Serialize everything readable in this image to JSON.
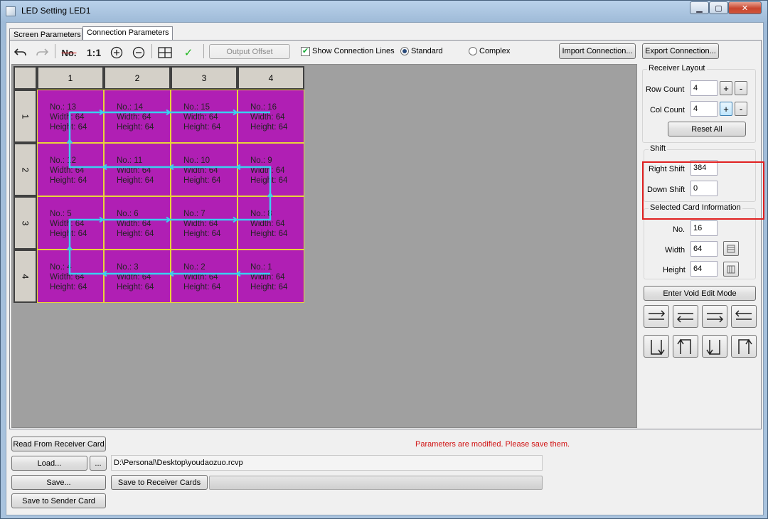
{
  "window": {
    "title": "LED Setting LED1",
    "controls": {
      "minimize": "▁",
      "maximize": "▢",
      "close": "✕"
    }
  },
  "tabs": [
    {
      "label": "Screen Parameters"
    },
    {
      "label": "Connection Parameters"
    }
  ],
  "toolbar": {
    "no_label": "No.",
    "ratio_label": "1:1",
    "output_offset": "Output Offset",
    "show_lines_label": "Show Connection Lines",
    "show_lines_checked": "✔",
    "standard_label": "Standard",
    "complex_label": "Complex",
    "import_label": "Import Connection...",
    "export_label": "Export Connection..."
  },
  "grid": {
    "columns": [
      "1",
      "2",
      "3",
      "4"
    ],
    "rows": [
      "1",
      "2",
      "3",
      "4"
    ],
    "cells": [
      [
        {
          "no": "No.: 13",
          "width": "Width: 64",
          "height": "Height: 64"
        },
        {
          "no": "No.: 14",
          "width": "Width: 64",
          "height": "Height: 64"
        },
        {
          "no": "No.: 15",
          "width": "Width: 64",
          "height": "Height: 64"
        },
        {
          "no": "No.: 16",
          "width": "Width: 64",
          "height": "Height: 64"
        }
      ],
      [
        {
          "no": "No.: 12",
          "width": "Width: 64",
          "height": "Height: 64"
        },
        {
          "no": "No.: 11",
          "width": "Width: 64",
          "height": "Height: 64"
        },
        {
          "no": "No.: 10",
          "width": "Width: 64",
          "height": "Height: 64"
        },
        {
          "no": "No.: 9",
          "width": "Width: 64",
          "height": "Height: 64"
        }
      ],
      [
        {
          "no": "No.: 5",
          "width": "Width: 64",
          "height": "Height: 64"
        },
        {
          "no": "No.: 6",
          "width": "Width: 64",
          "height": "Height: 64"
        },
        {
          "no": "No.: 7",
          "width": "Width: 64",
          "height": "Height: 64"
        },
        {
          "no": "No.: 8",
          "width": "Width: 64",
          "height": "Height: 64"
        }
      ],
      [
        {
          "no": "No.: 4",
          "width": "Width: 64",
          "height": "Height: 64"
        },
        {
          "no": "No.: 3",
          "width": "Width: 64",
          "height": "Height: 64"
        },
        {
          "no": "No.: 2",
          "width": "Width: 64",
          "height": "Height: 64"
        },
        {
          "no": "No.: 1",
          "width": "Width: 64",
          "height": "Height: 64"
        }
      ]
    ],
    "cell_color": "#b01fb4",
    "line_color": "#3ad0f0"
  },
  "receiver_layout": {
    "title": "Receiver Layout",
    "row_count_label": "Row Count",
    "row_count": "4",
    "col_count_label": "Col Count",
    "col_count": "4",
    "plus": "+",
    "minus": "-",
    "reset_label": "Reset All"
  },
  "shift": {
    "title": "Shift",
    "right_label": "Right Shift",
    "right_value": "384",
    "down_label": "Down Shift",
    "down_value": "0",
    "highlight_color": "#e02020"
  },
  "card_info": {
    "title": "Selected Card Information",
    "no_label": "No.",
    "no_value": "16",
    "width_label": "Width",
    "width_value": "64",
    "height_label": "Height",
    "height_value": "64"
  },
  "void_edit_label": "Enter Void Edit Mode",
  "direction_buttons": [
    "row-right-icon",
    "row-left-icon",
    "row-right-alt-icon",
    "row-left-alt-icon",
    "col-down-icon",
    "col-up-icon",
    "col-down-alt-icon",
    "col-up-alt-icon"
  ],
  "bottom": {
    "read_label": "Read From Receiver Card",
    "warning": "Parameters are modified. Please save them.",
    "warning_color": "#d01010",
    "load_label": "Load...",
    "browse_label": "...",
    "path": "D:\\Personal\\Desktop\\youdaozuo.rcvp",
    "save_label": "Save...",
    "save_receiver_label": "Save to Receiver Cards",
    "save_sender_label": "Save to Sender Card"
  }
}
